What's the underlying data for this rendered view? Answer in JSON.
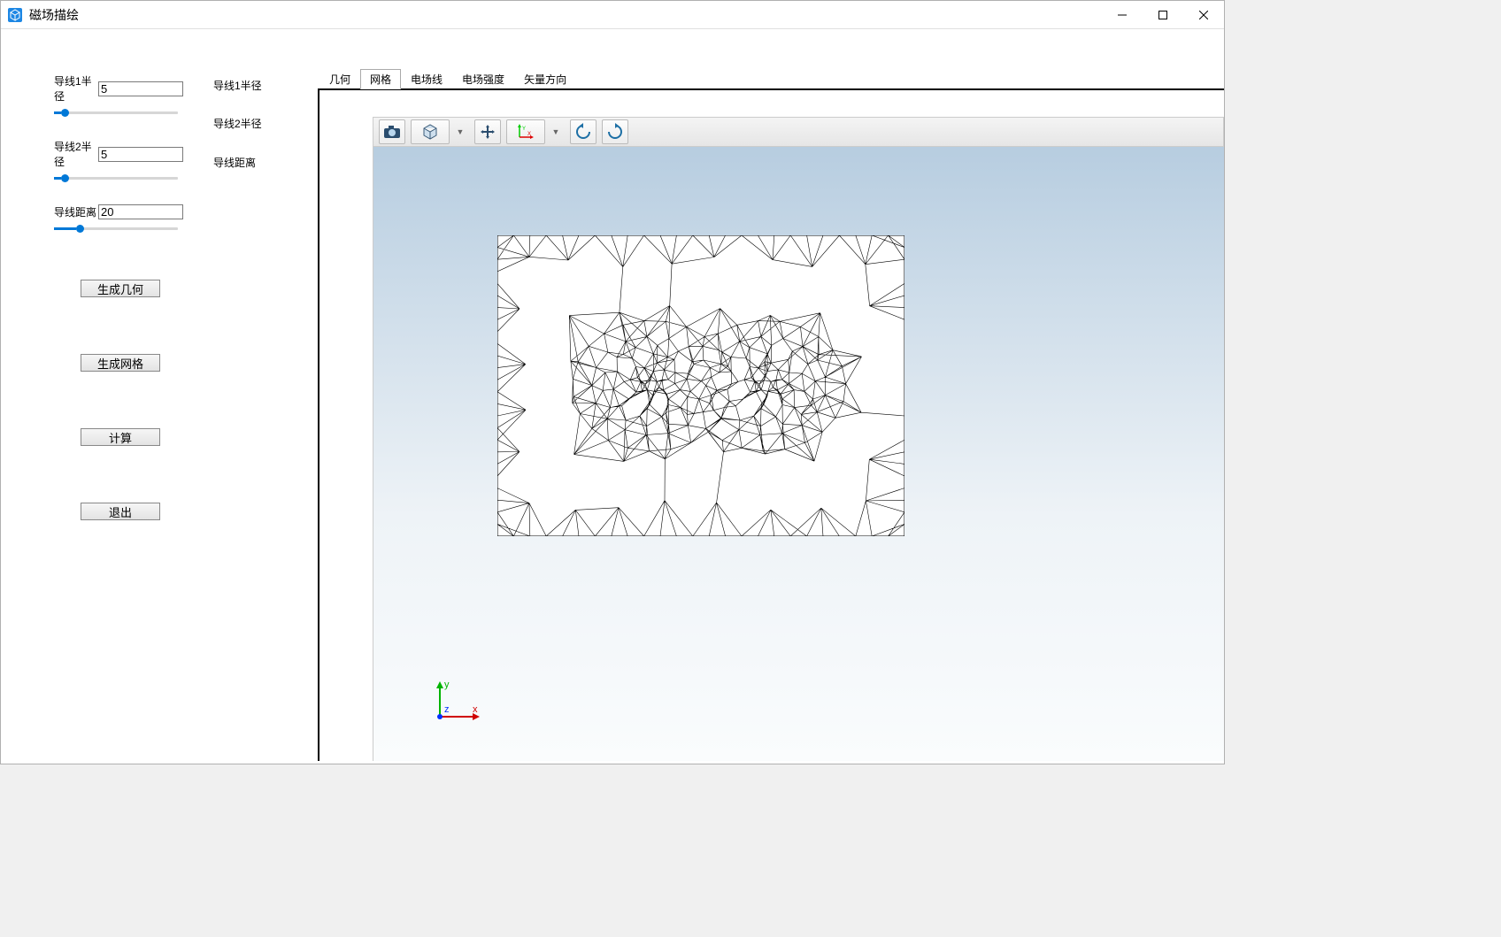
{
  "window": {
    "title": "磁场描绘"
  },
  "params": {
    "r1": {
      "label": "导线1半径",
      "value": "5",
      "side_label": "导线1半径",
      "slider_pct": 6
    },
    "r2": {
      "label": "导线2半径",
      "value": "5",
      "side_label": "导线2半径",
      "slider_pct": 6
    },
    "dist": {
      "label": "导线距离",
      "value": "20",
      "side_label": "导线距离",
      "slider_pct": 18
    }
  },
  "buttons": {
    "gen_geom": "生成几何",
    "gen_mesh": "生成网格",
    "compute": "计算",
    "exit": "退出"
  },
  "tabs": {
    "items": [
      "几何",
      "网格",
      "电场线",
      "电场强度",
      "矢量方向"
    ],
    "active_index": 1
  },
  "toolbar": {
    "camera": "camera-icon",
    "cube": "cube-icon",
    "pan": "pan-icon",
    "axes": "axes-icon",
    "rotate_ccw": "rotate-ccw-icon",
    "rotate_cw": "rotate-cw-icon"
  },
  "triad": {
    "x": "x",
    "y": "y",
    "z": "z"
  }
}
